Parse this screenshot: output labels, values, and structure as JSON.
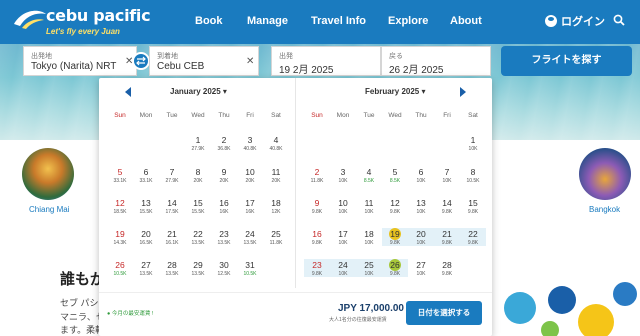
{
  "brand": {
    "name": "cebu pacific",
    "tagline": "Let's fly every Juan",
    "color_primary": "#1a7bbf",
    "color_accent": "#ffe066"
  },
  "nav": {
    "items": [
      "Book",
      "Manage",
      "Travel Info",
      "Explore",
      "About"
    ],
    "login_label": "ログイン",
    "search_icon": "search-icon"
  },
  "search": {
    "origin_label": "出発地",
    "origin_value": "Tokyo (Narita) NRT",
    "destination_label": "到着地",
    "destination_value": "Cebu CEB",
    "depart_label": "出発",
    "depart_value": "19 2月 2025",
    "return_label": "戻る",
    "return_value": "26 2月 2025",
    "search_button": "フライトを探す"
  },
  "background": {
    "dest_left_label": "Chiang Mai",
    "dest_right_label": "Bangkok",
    "heading": "誰もが",
    "text_line1": "セブ パシ",
    "text_line2": "マニラ、セ",
    "text_line3": "ます。柔軟"
  },
  "calendar": {
    "weekdays": [
      "Sun",
      "Mon",
      "Tue",
      "Wed",
      "Thu",
      "Fri",
      "Sat"
    ],
    "months": [
      {
        "title": "January 2025",
        "first_weekday": 3,
        "days": [
          {
            "d": "1",
            "p": "27.9K"
          },
          {
            "d": "2",
            "p": "36.8K"
          },
          {
            "d": "3",
            "p": "40.8K"
          },
          {
            "d": "4",
            "p": "40.8K"
          },
          {
            "d": "5",
            "p": "33.1K"
          },
          {
            "d": "6",
            "p": "33.1K"
          },
          {
            "d": "7",
            "p": "27.9K"
          },
          {
            "d": "8",
            "p": "20K"
          },
          {
            "d": "9",
            "p": "20K"
          },
          {
            "d": "10",
            "p": "20K"
          },
          {
            "d": "11",
            "p": "20K"
          },
          {
            "d": "12",
            "p": "18.5K"
          },
          {
            "d": "13",
            "p": "15.5K"
          },
          {
            "d": "14",
            "p": "17.5K"
          },
          {
            "d": "15",
            "p": "15.5K"
          },
          {
            "d": "16",
            "p": "16K"
          },
          {
            "d": "17",
            "p": "16K"
          },
          {
            "d": "18",
            "p": "12K"
          },
          {
            "d": "19",
            "p": "14.3K"
          },
          {
            "d": "20",
            "p": "16.5K"
          },
          {
            "d": "21",
            "p": "16.1K"
          },
          {
            "d": "22",
            "p": "13.5K"
          },
          {
            "d": "23",
            "p": "13.5K"
          },
          {
            "d": "24",
            "p": "13.5K"
          },
          {
            "d": "25",
            "p": "11.8K"
          },
          {
            "d": "26",
            "p": "10.5K",
            "g": true
          },
          {
            "d": "27",
            "p": "13.5K"
          },
          {
            "d": "28",
            "p": "13.5K"
          },
          {
            "d": "29",
            "p": "13.5K"
          },
          {
            "d": "30",
            "p": "12.5K"
          },
          {
            "d": "31",
            "p": "10.5K",
            "g": true
          }
        ]
      },
      {
        "title": "February 2025",
        "first_weekday": 6,
        "days": [
          {
            "d": "1",
            "p": "10K"
          },
          {
            "d": "2",
            "p": "11.8K"
          },
          {
            "d": "3",
            "p": "10K"
          },
          {
            "d": "4",
            "p": "8.5K",
            "g": true
          },
          {
            "d": "5",
            "p": "8.5K",
            "g": true
          },
          {
            "d": "6",
            "p": "10K"
          },
          {
            "d": "7",
            "p": "10K"
          },
          {
            "d": "8",
            "p": "10.5K"
          },
          {
            "d": "9",
            "p": "9.8K"
          },
          {
            "d": "10",
            "p": "10K"
          },
          {
            "d": "11",
            "p": "10K"
          },
          {
            "d": "12",
            "p": "9.8K"
          },
          {
            "d": "13",
            "p": "10K"
          },
          {
            "d": "14",
            "p": "9.8K"
          },
          {
            "d": "15",
            "p": "9.8K"
          },
          {
            "d": "16",
            "p": "9.8K"
          },
          {
            "d": "17",
            "p": "10K"
          },
          {
            "d": "18",
            "p": "10K"
          },
          {
            "d": "19",
            "p": "9.8K",
            "sel": 1
          },
          {
            "d": "20",
            "p": "10K",
            "r": true
          },
          {
            "d": "21",
            "p": "9.8K",
            "r": true
          },
          {
            "d": "22",
            "p": "9.8K",
            "r": true
          },
          {
            "d": "23",
            "p": "9.8K",
            "r": true
          },
          {
            "d": "24",
            "p": "10K",
            "r": true
          },
          {
            "d": "25",
            "p": "10K",
            "r": true
          },
          {
            "d": "26",
            "p": "9.8K",
            "sel": 2
          },
          {
            "d": "27",
            "p": "10K"
          },
          {
            "d": "28",
            "p": "9.8K"
          }
        ]
      }
    ],
    "legend": "● 今月の最安運賃 !",
    "price": "JPY 17,000.00",
    "price_note": "大人1名分の往復最安運賃",
    "select_button": "日付を選択する"
  }
}
